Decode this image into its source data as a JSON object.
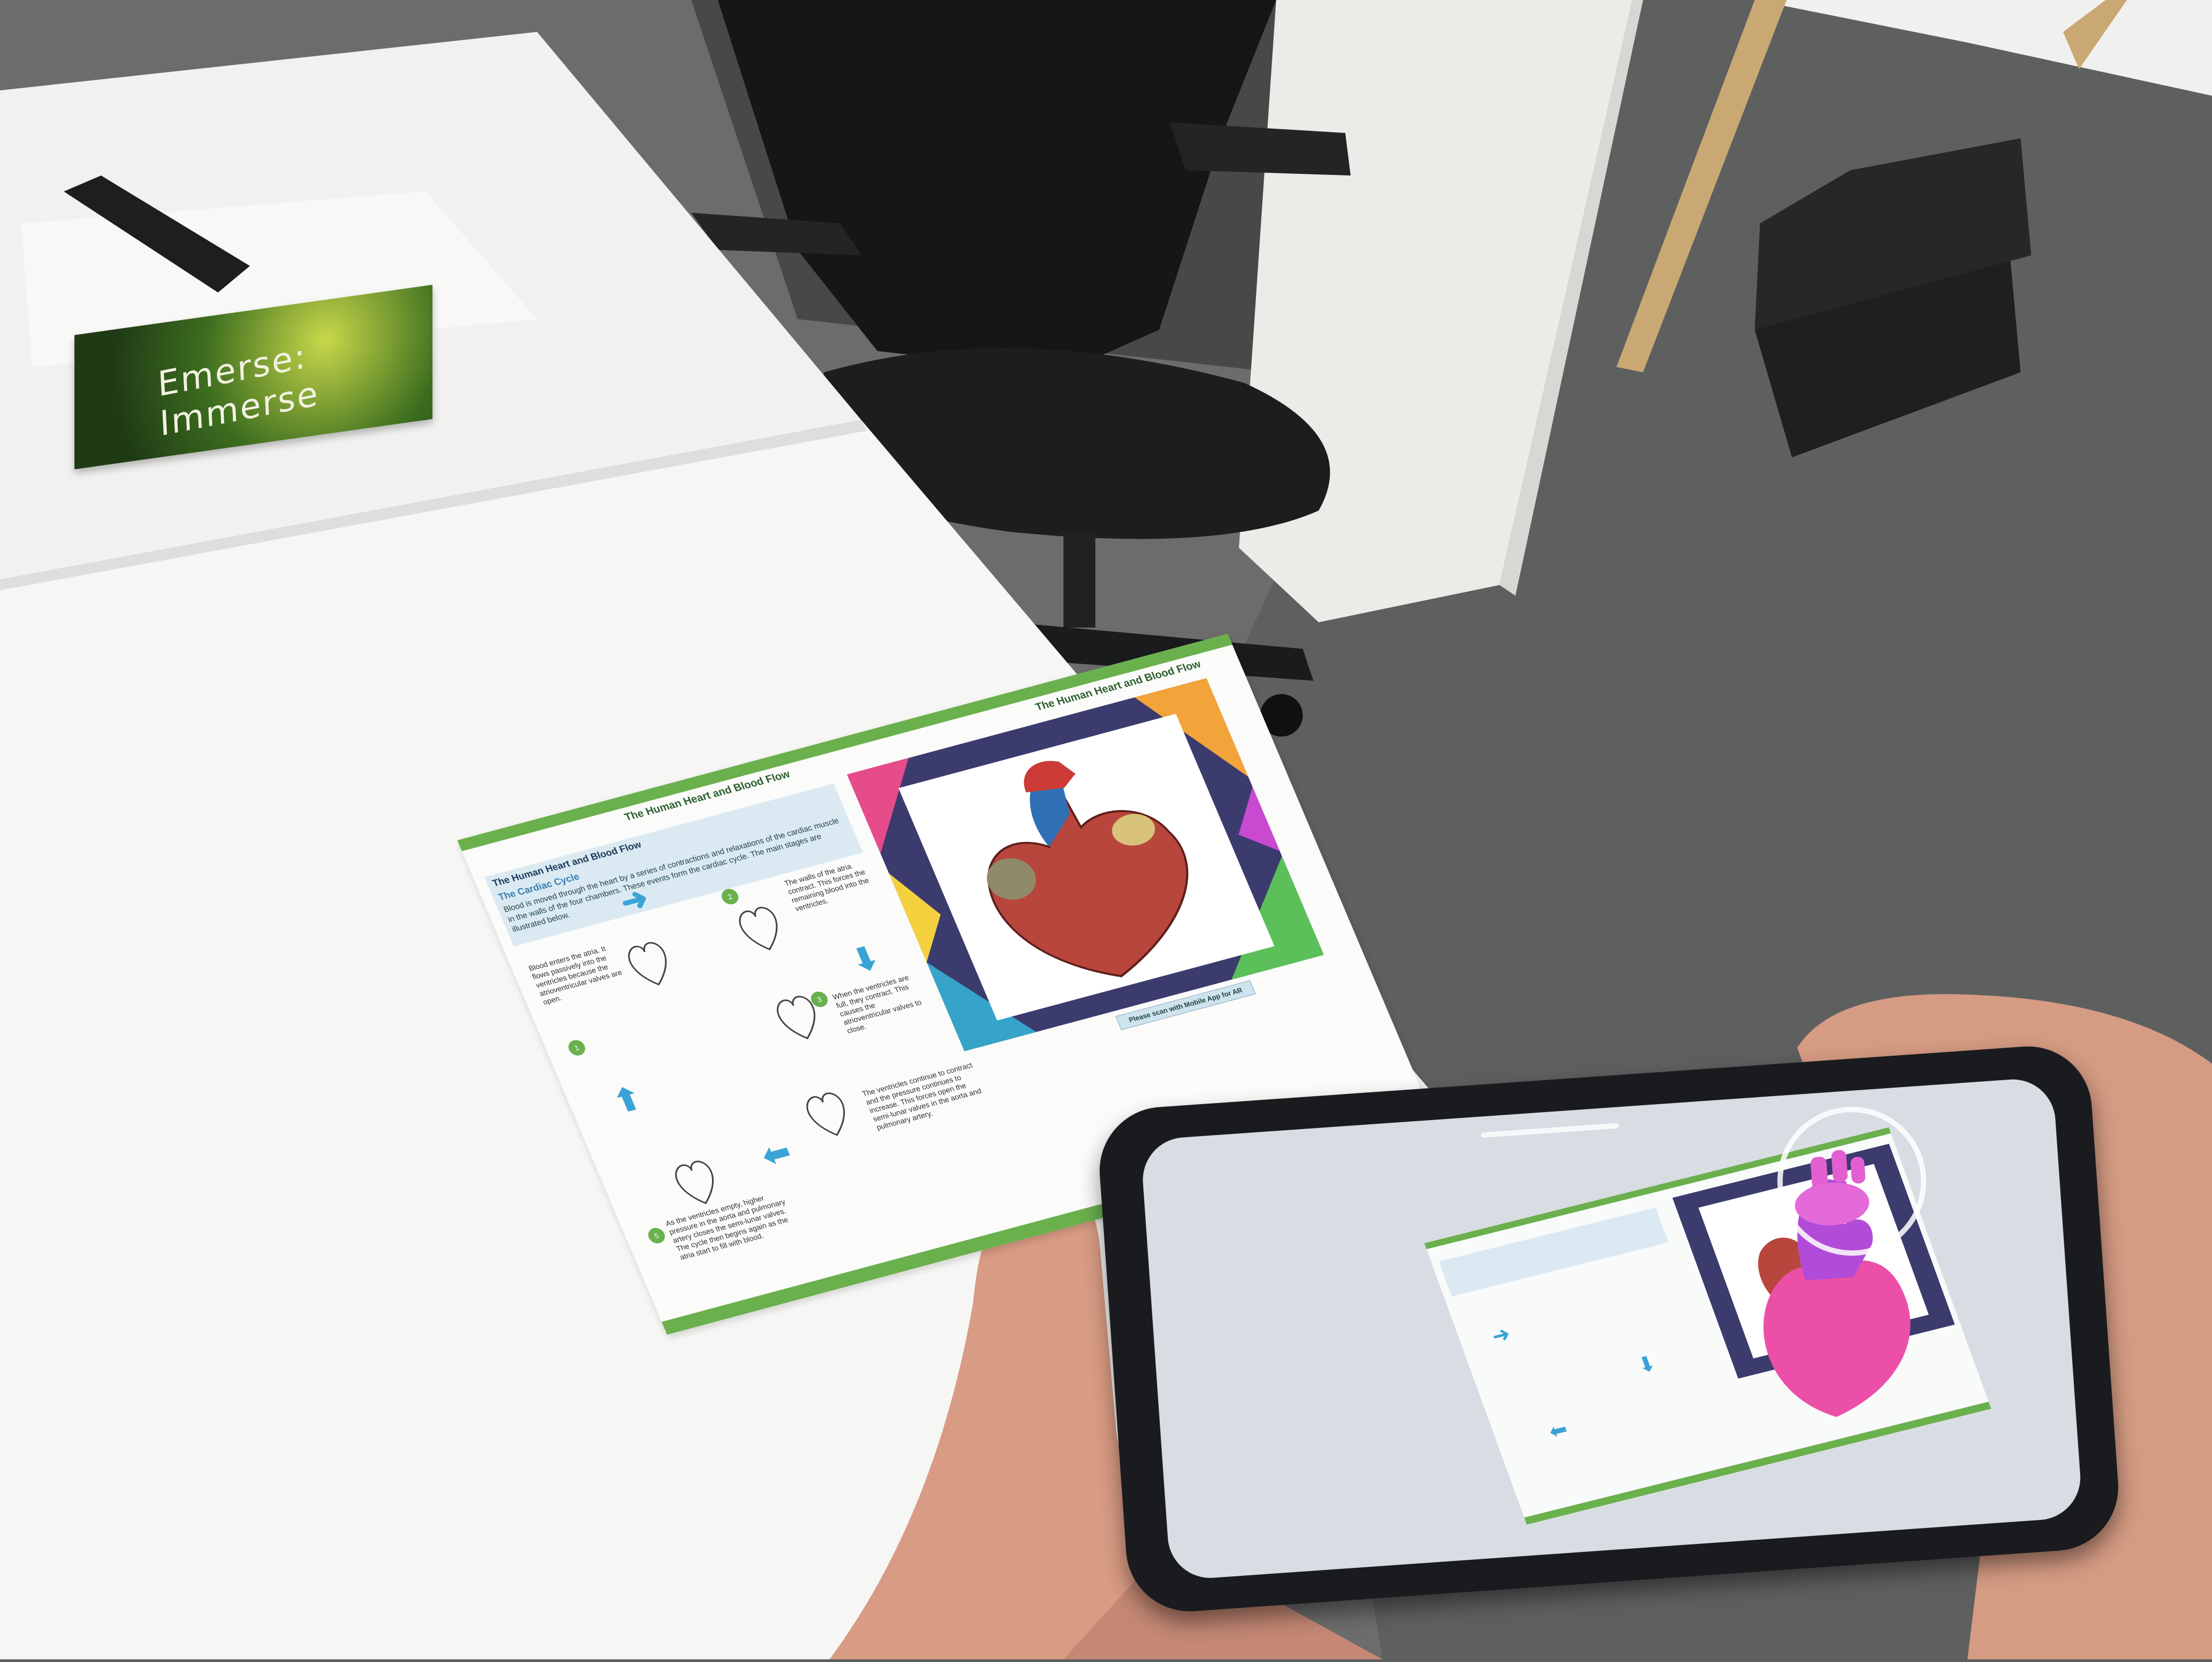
{
  "scene": {
    "description_labels": {
      "desk": "desk",
      "chair": "office chair",
      "pillar": "pillar",
      "remote": "tv remote"
    }
  },
  "booklet": {
    "title_line1": "Emerse:",
    "title_line2": "Immerse"
  },
  "sheet": {
    "header_left": "The Human Heart and Blood Flow",
    "header_right": "The Human Heart and Blood Flow",
    "title": "The Human Heart and Blood Flow",
    "subtitle": "The Cardiac Cycle",
    "intro": "Blood is moved through the heart by a series of contractions and relaxations of the cardiac muscle in the walls of the four chambers. These events form the cardiac cycle. The main stages are illustrated below.",
    "steps": [
      {
        "num": "1",
        "text": "Blood enters the atria. It flows passively into the ventricles because the atrioventricular valves are open."
      },
      {
        "num": "2",
        "text": "The walls of the atria contract. This forces the remaining blood into the ventricles."
      },
      {
        "num": "3",
        "text": "When the ventricles are full, they contract. This causes the atrioventricular valves to close."
      },
      {
        "num": "4",
        "text": "The ventricles continue to contract and the pressure continues to increase. This forces open the semi-lunar valves in the aorta and pulmonary artery."
      },
      {
        "num": "5",
        "text": "As the ventricles empty, higher pressure in the aorta and pulmonary artery closes the semi-lunar valves. The cycle then begins again as the atria start to fill with blood."
      }
    ],
    "read_more": "Please scan with Mobile App for AR"
  },
  "phone": {
    "screen_note": "AR camera view"
  },
  "colors": {
    "green_band": "#6ab04c",
    "title_box": "#dbeaf2",
    "arrow": "#3aa3d6",
    "ar_heart": "#ec4fa7",
    "ar_heart_dark": "#b24bd8"
  }
}
